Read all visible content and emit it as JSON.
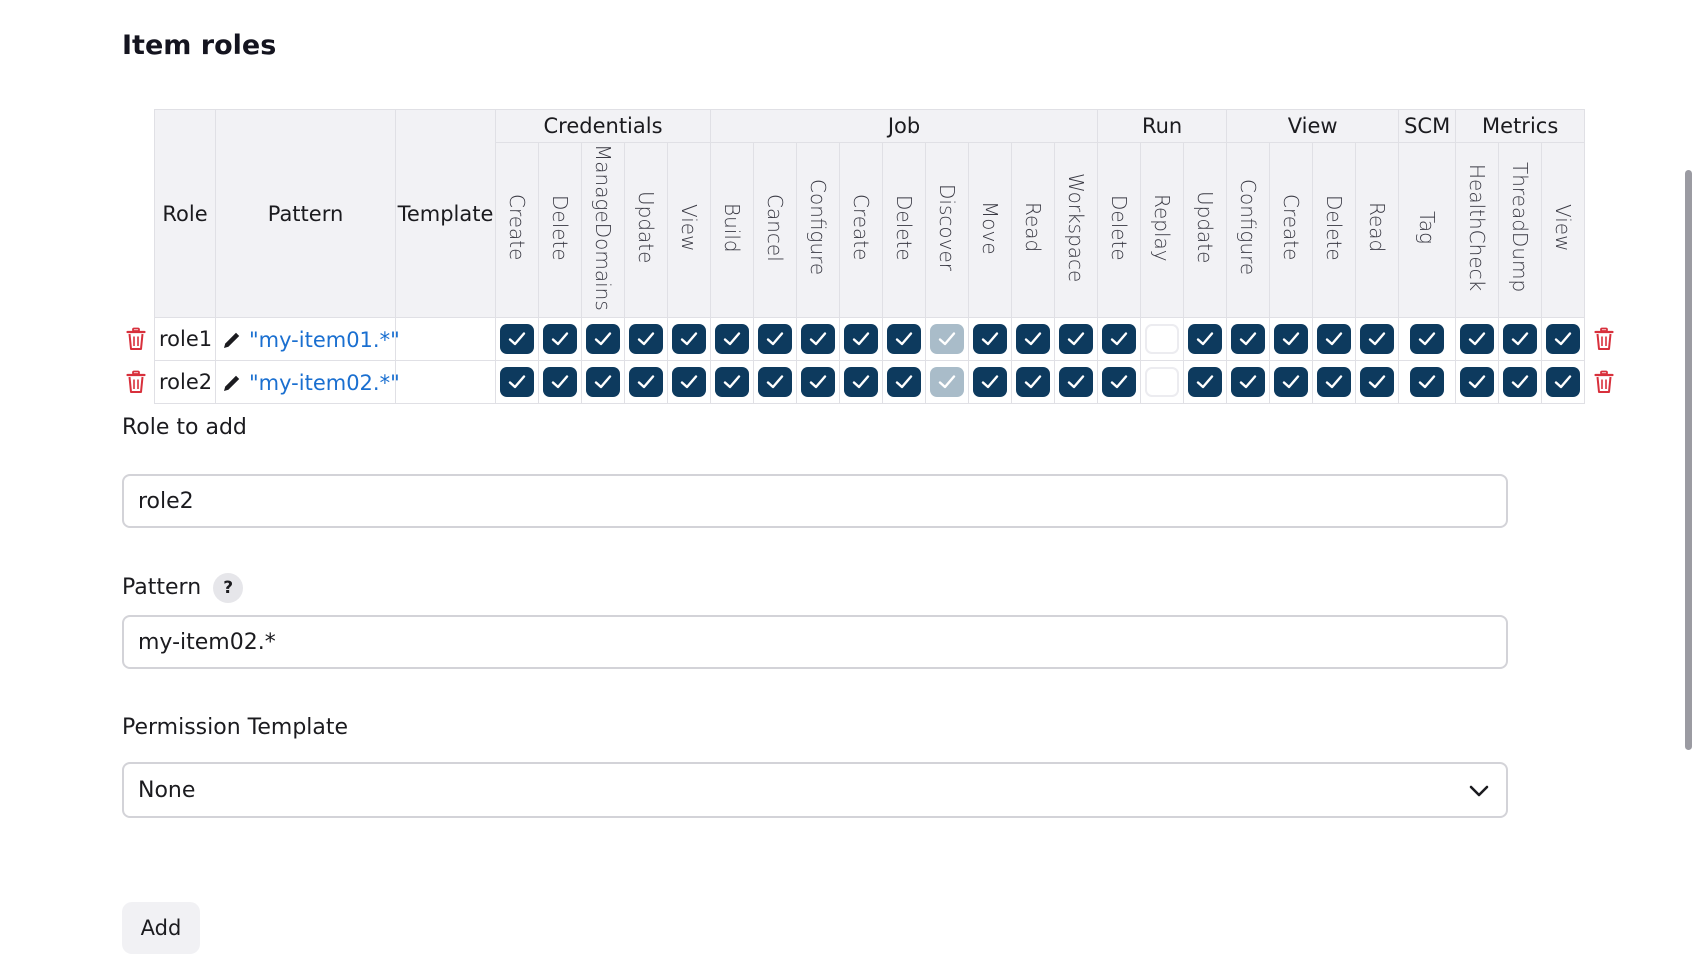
{
  "section_title": "Item roles",
  "table": {
    "headers": {
      "role": "Role",
      "pattern": "Pattern",
      "template": "Template"
    },
    "groups": [
      {
        "name": "Credentials",
        "perms": [
          "Create",
          "Delete",
          "ManageDomains",
          "Update",
          "View"
        ]
      },
      {
        "name": "Job",
        "perms": [
          "Build",
          "Cancel",
          "Configure",
          "Create",
          "Delete",
          "Discover",
          "Move",
          "Read",
          "Workspace"
        ]
      },
      {
        "name": "Run",
        "perms": [
          "Delete",
          "Replay",
          "Update"
        ]
      },
      {
        "name": "View",
        "perms": [
          "Configure",
          "Create",
          "Delete",
          "Read"
        ]
      },
      {
        "name": "SCM",
        "perms": [
          "Tag"
        ]
      },
      {
        "name": "Metrics",
        "perms": [
          "HealthCheck",
          "ThreadDump",
          "View"
        ]
      }
    ],
    "rows": [
      {
        "role": "role1",
        "pattern": "\"my-item01.*\"",
        "template": "",
        "checks": [
          "on",
          "on",
          "on",
          "on",
          "on",
          "on",
          "on",
          "on",
          "on",
          "on",
          "disabled",
          "on",
          "on",
          "on",
          "on",
          "off",
          "on",
          "on",
          "on",
          "on",
          "on",
          "on",
          "on",
          "on",
          "on"
        ]
      },
      {
        "role": "role2",
        "pattern": "\"my-item02.*\"",
        "template": "",
        "checks": [
          "on",
          "on",
          "on",
          "on",
          "on",
          "on",
          "on",
          "on",
          "on",
          "on",
          "disabled",
          "on",
          "on",
          "on",
          "on",
          "off",
          "on",
          "on",
          "on",
          "on",
          "on",
          "on",
          "on",
          "on",
          "on"
        ]
      }
    ]
  },
  "form": {
    "role_label": "Role to add",
    "role_value": "role2",
    "pattern_label": "Pattern",
    "pattern_help": "?",
    "pattern_value": "my-item02.*",
    "template_label": "Permission Template",
    "template_value": "None",
    "add_button": "Add"
  },
  "colors": {
    "checked": "#0d3a5e",
    "disabled": "#a9bcc9",
    "link": "#1a6fd0",
    "trash": "#d8303c"
  },
  "icons": {
    "delete": "trash-icon",
    "edit": "pencil-icon",
    "check": "checkmark-icon",
    "dropdown": "chevron-down-icon"
  }
}
